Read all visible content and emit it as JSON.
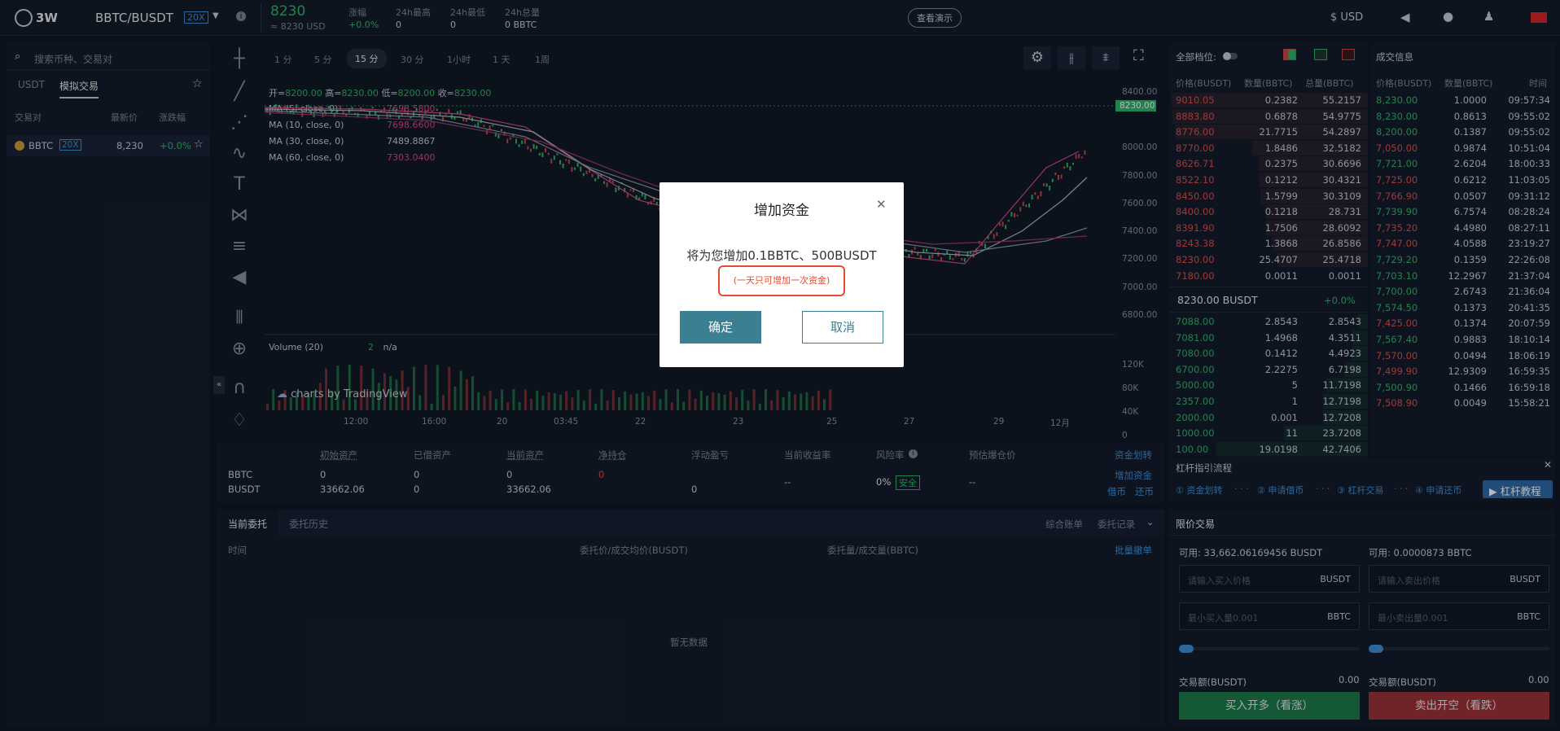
{
  "header": {
    "logo": "3W",
    "pair": "BBTC/BUSDT",
    "leverage": "20X",
    "price": "8230",
    "price_usd": "≈ 8230 USD",
    "stats": [
      {
        "label": "涨幅",
        "value": "+0.0%"
      },
      {
        "label": "24h最高",
        "value": "0"
      },
      {
        "label": "24h最低",
        "value": "0"
      },
      {
        "label": "24h总量",
        "value": "0 BBTC"
      }
    ],
    "demo_button": "查看演示",
    "currency": "$ USD"
  },
  "sidebar": {
    "search_placeholder": "搜索币种、交易对",
    "tabs": [
      "USDT",
      "模拟交易"
    ],
    "columns": [
      "交易对",
      "最新价",
      "涨跌幅"
    ],
    "pair": {
      "name": "BBTC",
      "lev": "20X",
      "price": "8,230",
      "change": "+0.0%"
    }
  },
  "chart": {
    "intervals": [
      "1 分",
      "5 分",
      "15 分",
      "30 分",
      "1小时",
      "1 天",
      "1周"
    ],
    "active_interval": "15 分",
    "ohlc": {
      "open_label": "开=",
      "open": "8200.00",
      "high_label": "高=",
      "high": "8230.00",
      "low_label": "低=",
      "low": "8200.00",
      "close_label": "收=",
      "close": "8230.00"
    },
    "ma": [
      {
        "label": "MA (5, close, 0)",
        "value": "7698.5800",
        "color": "#d9488a"
      },
      {
        "label": "MA (10, close, 0)",
        "value": "7698.6600",
        "color": "#d9488a"
      },
      {
        "label": "MA (30, close, 0)",
        "value": "7489.8867",
        "color": "#b0b8c6"
      },
      {
        "label": "MA (60, close, 0)",
        "value": "7303.0400",
        "color": "#d9488a"
      }
    ],
    "y_ticks": [
      "8400.00",
      "8200.00",
      "8000.00",
      "7800.00",
      "7600.00",
      "7400.00",
      "7200.00",
      "7000.00",
      "6800.00"
    ],
    "current_price_tag": "8230.00",
    "volume_label": "Volume (20)",
    "volume_value": "2",
    "volume_na": "n/a",
    "vol_ticks": [
      "120K",
      "80K",
      "40K",
      "0"
    ],
    "x_ticks": [
      "12:00",
      "16:00",
      "20",
      "03:45",
      "22",
      "23",
      "25",
      "27",
      "29",
      "12月"
    ],
    "watermark": "charts by TradingView"
  },
  "assets": {
    "headers": [
      "初始资产",
      "已借资产",
      "当前资产",
      "净持仓",
      "浮动盈亏",
      "当前收益率",
      "风险率",
      "预估爆仓价"
    ],
    "transfer": "资金划转",
    "rows": [
      {
        "coin": "BBTC",
        "init": "0",
        "borrowed": "0",
        "current": "0",
        "net": "0"
      },
      {
        "coin": "BUSDT",
        "init": "33662.06",
        "borrowed": "0",
        "current": "33662.06",
        "pnl": "0"
      }
    ],
    "yield": "--",
    "risk": "0%",
    "risk_badge": "安全",
    "liq": "--",
    "add_funds": "增加资金",
    "borrow": "借币",
    "repay": "还币"
  },
  "orders": {
    "tabs": [
      "当前委托",
      "委托历史"
    ],
    "right": [
      "综合账单",
      "委托记录"
    ],
    "columns": [
      "时间",
      "委托价/成交均价(BUSDT)",
      "委托量/成交量(BBTC)"
    ],
    "batch_cancel": "批量撤单",
    "empty": "暂无数据"
  },
  "orderbook": {
    "title": "全部档位:",
    "columns": [
      "价格(BUSDT)",
      "数量(BBTC)",
      "总量(BBTC)"
    ],
    "asks": [
      [
        "9010.05",
        "0.2382",
        "55.2157"
      ],
      [
        "8883.80",
        "0.6878",
        "54.9775"
      ],
      [
        "8776.00",
        "21.7715",
        "54.2897"
      ],
      [
        "8770.00",
        "1.8486",
        "32.5182"
      ],
      [
        "8626.71",
        "0.2375",
        "30.6696"
      ],
      [
        "8522.10",
        "0.1212",
        "30.4321"
      ],
      [
        "8450.00",
        "1.5799",
        "30.3109"
      ],
      [
        "8400.00",
        "0.1218",
        "28.731"
      ],
      [
        "8391.90",
        "1.7506",
        "28.6092"
      ],
      [
        "8243.38",
        "1.3868",
        "26.8586"
      ],
      [
        "8230.00",
        "25.4707",
        "25.4718"
      ],
      [
        "7180.00",
        "0.0011",
        "0.0011"
      ]
    ],
    "mid_price": "8230.00 BUSDT",
    "mid_change": "+0.0%",
    "bids": [
      [
        "7088.00",
        "2.8543",
        "2.8543"
      ],
      [
        "7081.00",
        "1.4968",
        "4.3511"
      ],
      [
        "7080.00",
        "0.1412",
        "4.4923"
      ],
      [
        "6700.00",
        "2.2275",
        "6.7198"
      ],
      [
        "5000.00",
        "5",
        "11.7198"
      ],
      [
        "2357.00",
        "1",
        "12.7198"
      ],
      [
        "2000.00",
        "0.001",
        "12.7208"
      ],
      [
        "1000.00",
        "11",
        "23.7208"
      ],
      [
        "100.00",
        "19.0198",
        "42.7406"
      ]
    ]
  },
  "trades": {
    "title": "成交信息",
    "columns": [
      "价格(BUSDT)",
      "数量(BBTC)",
      "时间"
    ],
    "rows": [
      [
        "8,230.00",
        "1.0000",
        "09:57:34",
        "g"
      ],
      [
        "8,230.00",
        "0.8613",
        "09:55:02",
        "g"
      ],
      [
        "8,200.00",
        "0.1387",
        "09:55:02",
        "g"
      ],
      [
        "7,050.00",
        "0.9874",
        "10:51:04",
        "r"
      ],
      [
        "7,721.00",
        "2.6204",
        "18:00:33",
        "g"
      ],
      [
        "7,725.00",
        "0.6212",
        "11:03:05",
        "r"
      ],
      [
        "7,766.90",
        "0.0507",
        "09:31:12",
        "r"
      ],
      [
        "7,739.90",
        "6.7574",
        "08:28:24",
        "g"
      ],
      [
        "7,735.20",
        "4.4980",
        "08:27:11",
        "r"
      ],
      [
        "7,747.00",
        "4.0588",
        "23:19:27",
        "r"
      ],
      [
        "7,729.20",
        "0.1359",
        "22:26:08",
        "g"
      ],
      [
        "7,703.10",
        "12.2967",
        "21:37:04",
        "g"
      ],
      [
        "7,700.00",
        "2.6743",
        "21:36:04",
        "g"
      ],
      [
        "7,574.50",
        "0.1373",
        "20:41:35",
        "g"
      ],
      [
        "7,425.00",
        "0.1374",
        "20:07:59",
        "r"
      ],
      [
        "7,567.40",
        "0.9883",
        "18:10:14",
        "g"
      ],
      [
        "7,570.00",
        "0.0494",
        "18:06:19",
        "r"
      ],
      [
        "7,499.90",
        "12.9309",
        "16:59:35",
        "r"
      ],
      [
        "7,500.90",
        "0.1466",
        "16:59:18",
        "g"
      ],
      [
        "7,508.90",
        "0.0049",
        "15:58:21",
        "r"
      ]
    ]
  },
  "leverage_flow": {
    "title": "杠杆指引流程",
    "steps": [
      "① 资金划转",
      "② 申请借币",
      "③ 杠杆交易",
      "④ 申请还币"
    ],
    "tutorial": "杠杆教程"
  },
  "trade_form": {
    "title": "限价交易",
    "buy_avail": "可用: 33,662.06169456 BUSDT",
    "sell_avail": "可用: 0.0000873 BBTC",
    "buy_price_ph": "请输入买入价格",
    "sell_price_ph": "请输入卖出价格",
    "unit_busdt": "BUSDT",
    "buy_qty_ph": "最小买入量0.001",
    "sell_qty_ph": "最小卖出量0.001",
    "unit_bbtc": "BBTC",
    "amount_label": "交易额(BUSDT)",
    "amount": "0.00",
    "buy_button": "买入开多（看涨）",
    "sell_button": "卖出开空（看跌）"
  },
  "modal": {
    "title": "增加资金",
    "message": "将为您增加0.1BBTC、500BUSDT",
    "note": "(一天只可增加一次资金)",
    "confirm": "确定",
    "cancel": "取消"
  }
}
